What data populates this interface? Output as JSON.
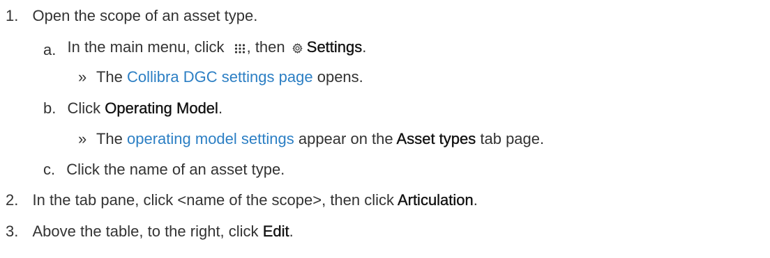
{
  "steps": [
    {
      "number": "1.",
      "text": "Open the scope of an asset type."
    },
    {
      "number": "a.",
      "text_1": "In the main menu, click",
      "icon_1": "apps-grid-icon",
      "text_2": ", then",
      "icon_2": "gear-icon",
      "text_bold": "Settings",
      "text_end": "."
    },
    {
      "marker": "»",
      "text_1": "The",
      "link": "Collibra DGC settings page",
      "text_2": "opens."
    },
    {
      "number": "b.",
      "text_1": "Click",
      "text_bold": "Operating Model",
      "text_end": "."
    },
    {
      "marker": "»",
      "text_1": "The",
      "link": "operating model settings",
      "text_2": "appear on the",
      "text_bold": "Asset types",
      "text_3": "tab page."
    },
    {
      "number": "c.",
      "text": "Click the name of an asset type."
    },
    {
      "number": "2.",
      "text_1": "In the tab pane, click <name of the scope>, then click",
      "text_bold": "Articulation",
      "text_end": "."
    },
    {
      "number": "3.",
      "text_1": "Above the table, to the right, click",
      "text_bold": "Edit",
      "text_end": "."
    }
  ],
  "colors": {
    "text": "#333333",
    "link": "#2c7fc4",
    "background": "#ffffff"
  }
}
